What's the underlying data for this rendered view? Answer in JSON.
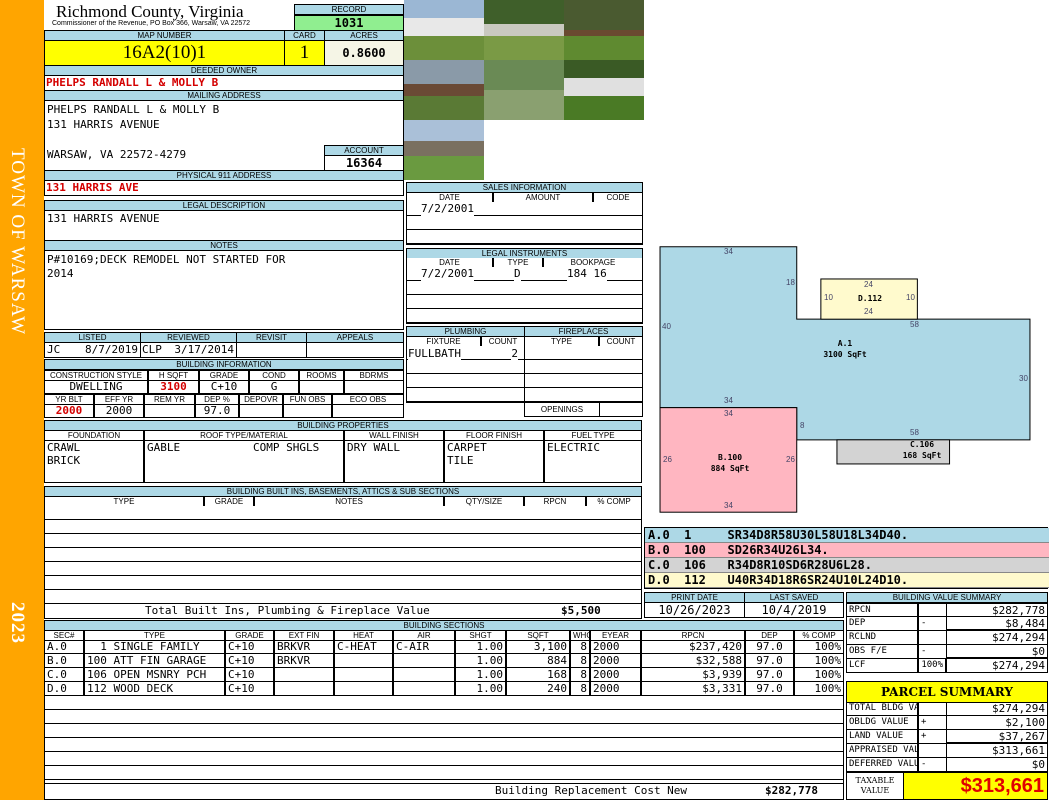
{
  "sidebar": {
    "town": "TOWN OF WARSAW",
    "year": "2023"
  },
  "header": {
    "county": "Richmond County, Virginia",
    "subtitle": "Commissioner of the Revenue, PO Box 366, Warsaw, VA 22572",
    "record_label": "RECORD",
    "record": "1031"
  },
  "parcel": {
    "map_label": "MAP NUMBER",
    "map": "16A2(10)1",
    "card_label": "CARD",
    "card": "1",
    "acres_label": "ACRES",
    "acres": "0.8600"
  },
  "owner": {
    "label": "DEEDED OWNER",
    "value": "PHELPS RANDALL L & MOLLY B"
  },
  "mailing": {
    "label": "MAILING ADDRESS",
    "line1": "PHELPS RANDALL L & MOLLY B",
    "line2": "131 HARRIS AVENUE",
    "line3": "WARSAW, VA 22572-4279",
    "account_label": "ACCOUNT",
    "account": "16364"
  },
  "physical": {
    "label": "PHYSICAL 911 ADDRESS",
    "value": "131 HARRIS AVE"
  },
  "legal": {
    "label": "LEGAL DESCRIPTION",
    "value": "131 HARRIS AVENUE"
  },
  "notes": {
    "label": "NOTES",
    "line1": "P#10169;DECK REMODEL NOT STARTED FOR",
    "line2": "2014"
  },
  "listing": {
    "listed_label": "LISTED",
    "listed_by": "JC",
    "listed_date": "8/7/2019",
    "reviewed_label": "REVIEWED",
    "reviewed_by": "CLP",
    "reviewed_date": "3/17/2014",
    "revisit_label": "REVISIT",
    "appeals_label": "APPEALS"
  },
  "building_info": {
    "label": "BUILDING INFORMATION",
    "headers1": [
      "CONSTRUCTION STYLE",
      "H SQFT",
      "GRADE",
      "COND",
      "ROOMS",
      "BDRMS"
    ],
    "values1": [
      "DWELLING",
      "3100",
      "C+10",
      "G",
      "",
      ""
    ],
    "headers2": [
      "YR BLT",
      "EFF YR",
      "REM YR",
      "DEP %",
      "DEPOVR",
      "FUN OBS",
      "ECO OBS"
    ],
    "values2": [
      "2000",
      "2000",
      "",
      "97.0",
      "",
      "",
      ""
    ]
  },
  "properties": {
    "label": "BUILDING PROPERTIES",
    "headers": [
      "FOUNDATION",
      "ROOF TYPE/MATERIAL",
      "WALL FINISH",
      "FLOOR FINISH",
      "FUEL TYPE"
    ],
    "foundation": "CRAWL\nBRICK",
    "roof": "GABLE           COMP SHGLS",
    "wall": "DRY WALL",
    "floor": "CARPET\nTILE",
    "fuel": "ELECTRIC"
  },
  "builtins": {
    "label": "BUILDING BUILT INS, BASEMENTS, ATTICS & SUB SECTIONS",
    "headers": [
      "TYPE",
      "GRADE",
      "NOTES",
      "QTY/SIZE",
      "RPCN",
      "% COMP"
    ],
    "total_label": "Total Built Ins, Plumbing & Fireplace Value",
    "total": "$5,500"
  },
  "sales": {
    "label": "SALES INFORMATION",
    "headers": [
      "DATE",
      "AMOUNT",
      "CODE"
    ],
    "rows": [
      {
        "date": "7/2/2001"
      }
    ]
  },
  "instruments": {
    "label": "LEGAL INSTRUMENTS",
    "headers": [
      "DATE",
      "TYPE",
      "BOOKPAGE"
    ],
    "rows": [
      {
        "date": "7/2/2001",
        "type": "D",
        "bookpage": "184 16"
      }
    ]
  },
  "plumbing": {
    "label": "PLUMBING",
    "headers": [
      "FIXTURE",
      "COUNT"
    ],
    "rows": [
      {
        "fixture": "FULLBATH",
        "count": "2"
      }
    ]
  },
  "fireplaces": {
    "label": "FIREPLACES",
    "headers": [
      "TYPE",
      "COUNT"
    ],
    "openings_label": "OPENINGS"
  },
  "sketch": {
    "sections": [
      {
        "id": "A.1",
        "area": "3100 SqFt"
      },
      {
        "id": "B.100",
        "area": "884 SqFt"
      },
      {
        "id": "C.106",
        "area": "168 SqFt"
      },
      {
        "id": "D.112"
      }
    ],
    "dims": [
      "34",
      "18",
      "40",
      "58",
      "30",
      "34",
      "8",
      "58",
      "34",
      "26",
      "26",
      "34",
      "24",
      "10",
      "10",
      "24"
    ],
    "colors": {
      "A": "#ADD8E6",
      "B": "#FFB6C1",
      "C": "#D3D3D3",
      "D": "#FFFACD"
    },
    "codes": [
      {
        "sec": "A.0",
        "code": "1",
        "path": "SR34D8R58U30L58U18L34D40."
      },
      {
        "sec": "B.0",
        "code": "100",
        "path": "SD26R34U26L34."
      },
      {
        "sec": "C.0",
        "code": "106",
        "path": "R34D8R10SD6R28U6L28."
      },
      {
        "sec": "D.0",
        "code": "112",
        "path": "U40R34D18R6SR24U10L24D10."
      }
    ]
  },
  "dates": {
    "print_label": "PRINT DATE",
    "print": "10/26/2023",
    "saved_label": "LAST SAVED",
    "saved": "10/4/2019"
  },
  "sections": {
    "label": "BUILDING SECTIONS",
    "headers": [
      "SEC#",
      "TYPE",
      "GRADE",
      "EXT FIN",
      "HEAT",
      "AIR",
      "SHGT",
      "SQFT",
      "WHGT",
      "EYEAR",
      "RPCN",
      "DEP",
      "% COMP"
    ],
    "rows": [
      [
        "A.0",
        "  1 SINGLE FAMILY",
        "C+10",
        "BRKVR",
        "C-HEAT",
        "C-AIR",
        "1.00",
        "3,100",
        "8",
        "2000",
        "$237,420",
        "97.0",
        "100%"
      ],
      [
        "B.0",
        "100 ATT FIN GARAGE",
        "C+10",
        "BRKVR",
        "",
        "",
        "1.00",
        "884",
        "8",
        "2000",
        "$32,588",
        "97.0",
        "100%"
      ],
      [
        "C.0",
        "106 OPEN MSNRY PCH",
        "C+10",
        "",
        "",
        "",
        "1.00",
        "168",
        "8",
        "2000",
        "$3,939",
        "97.0",
        "100%"
      ],
      [
        "D.0",
        "112 WOOD DECK",
        "C+10",
        "",
        "",
        "",
        "1.00",
        "240",
        "8",
        "2000",
        "$3,331",
        "97.0",
        "100%"
      ]
    ],
    "replacement_label": "Building Replacement Cost New",
    "replacement": "$282,778"
  },
  "value_summary": {
    "label": "BUILDING VALUE SUMMARY",
    "rows": [
      {
        "label": "RPCN",
        "op": "",
        "value": "$282,778"
      },
      {
        "label": "DEP",
        "op": "-",
        "value": "$8,484"
      },
      {
        "label": "RCLND",
        "op": "",
        "value": "$274,294"
      },
      {
        "label": "OBS F/E",
        "op": "-",
        "value": "$0"
      },
      {
        "label": "LCF",
        "op": "100%",
        "value": "$274,294"
      }
    ]
  },
  "parcel_summary": {
    "label": "PARCEL SUMMARY",
    "rows": [
      {
        "label": "TOTAL BLDG VALUE",
        "op": "",
        "value": "$274,294"
      },
      {
        "label": "OBLDG VALUE",
        "op": "+",
        "value": "$2,100"
      },
      {
        "label": "LAND VALUE",
        "op": "+",
        "value": "$37,267"
      },
      {
        "label": "APPRAISED VALUE",
        "op": "",
        "value": "$313,661"
      },
      {
        "label": "DEFERRED VALUE",
        "op": "-",
        "value": "$0"
      }
    ],
    "taxable_label": "TAXABLE VALUE",
    "taxable": "$313,661"
  }
}
